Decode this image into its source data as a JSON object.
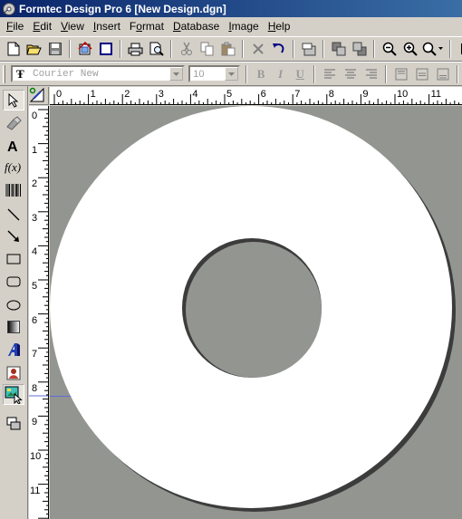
{
  "window": {
    "title": "Formtec Design Pro 6 [New Design.dgn]"
  },
  "menu": [
    {
      "pre": "",
      "acc": "F",
      "post": "ile"
    },
    {
      "pre": "",
      "acc": "E",
      "post": "dit"
    },
    {
      "pre": "",
      "acc": "V",
      "post": "iew"
    },
    {
      "pre": "",
      "acc": "I",
      "post": "nsert"
    },
    {
      "pre": "F",
      "acc": "o",
      "post": "rmat"
    },
    {
      "pre": "",
      "acc": "D",
      "post": "atabase"
    },
    {
      "pre": "",
      "acc": "I",
      "post": "mage"
    },
    {
      "pre": "",
      "acc": "H",
      "post": "elp"
    }
  ],
  "format_bar": {
    "font_name": "Courier New",
    "font_size": "10",
    "bold": "B",
    "italic": "I",
    "underline": "U"
  },
  "ruler": {
    "horizontal": [
      "0",
      "1",
      "2",
      "3",
      "4",
      "5",
      "6",
      "7",
      "8",
      "9",
      "10",
      "11"
    ],
    "vertical": [
      "0",
      "1",
      "2",
      "3",
      "4",
      "5",
      "6",
      "7",
      "8",
      "9",
      "10",
      "11"
    ]
  },
  "palette_tools": [
    "pointer",
    "shape-edit",
    "text",
    "formula",
    "barcode",
    "line",
    "arrow",
    "rectangle",
    "rounded-rectangle",
    "ellipse",
    "gradient",
    "word-art",
    "picture",
    "image-frame",
    "group"
  ],
  "colors": {
    "canvas": "#939590",
    "disc": "#ffffff",
    "title_start": "#0a246a",
    "title_end": "#3a6ea5"
  }
}
